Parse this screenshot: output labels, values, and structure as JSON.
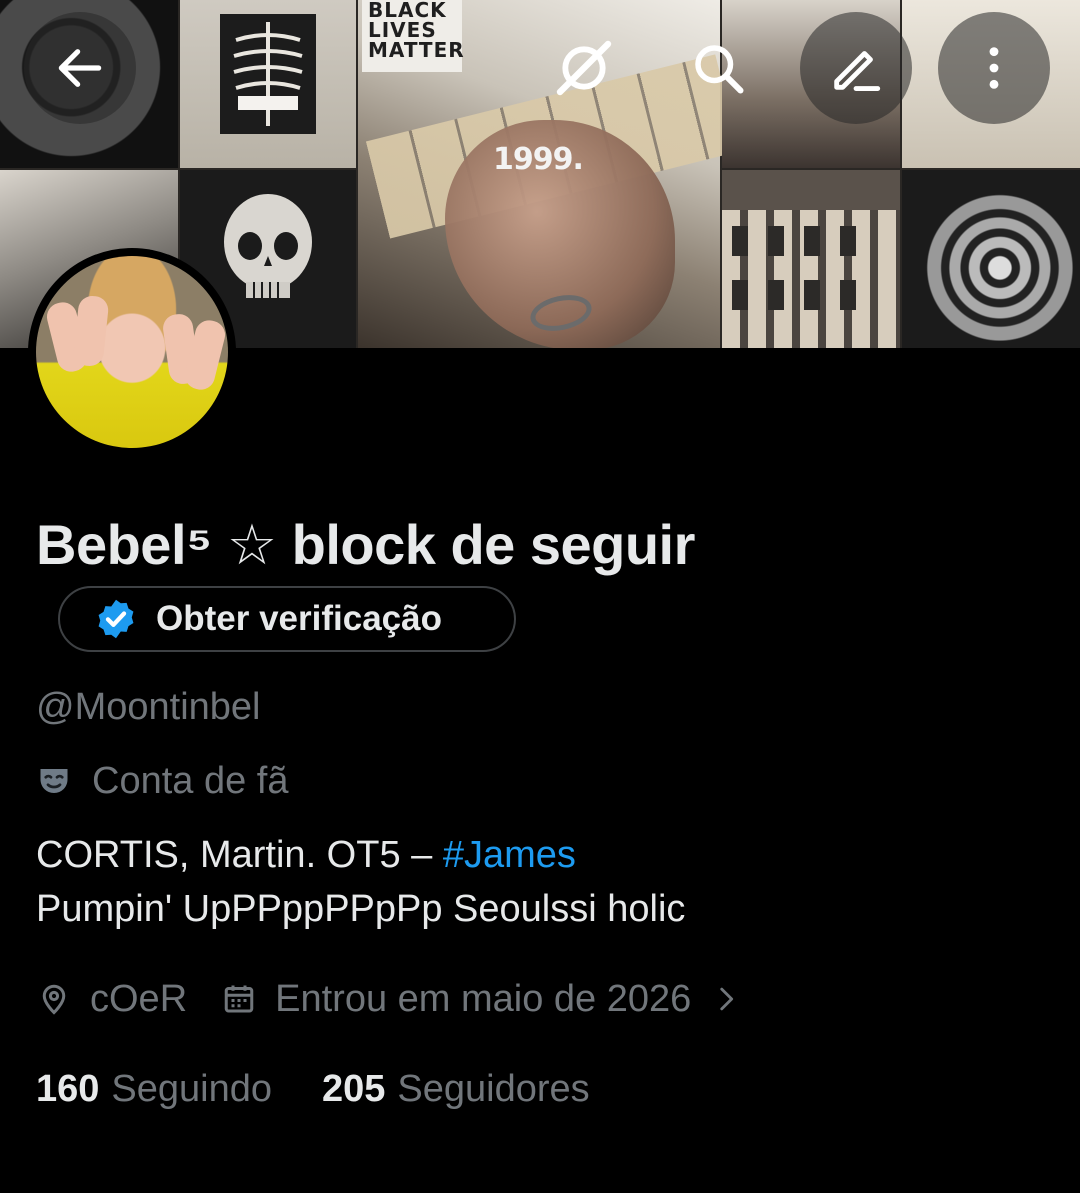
{
  "banner": {
    "sign_text": "BLACK\nLIVES\nMATTER",
    "year_text": "1999."
  },
  "topbar": {
    "back_icon": "arrow-left-icon",
    "grok_icon": "grok-icon",
    "search_icon": "search-icon",
    "edit_icon": "edit-pencil-icon",
    "more_icon": "more-vertical-icon"
  },
  "profile": {
    "display_name": "Bebel⁵ ☆ block de seguir",
    "verify_button_label": "Obter verificação",
    "handle": "@Moontinbel",
    "category": "Conta de fã",
    "category_icon": "theater-masks-icon",
    "bio_line1_text": "CORTIS, Martin. OT5 – ",
    "bio_line1_hashtag": "#James",
    "bio_line2": "Pumpin' UpPPppPPpPp Seoulssi holic",
    "location": "cOeR",
    "location_icon": "location-pin-icon",
    "joined": "Entrou em maio de 2026",
    "joined_icon": "calendar-icon",
    "more_chevron_icon": "chevron-right-icon"
  },
  "stats": {
    "following_count": "160",
    "following_label": "Seguindo",
    "followers_count": "205",
    "followers_label": "Seguidores"
  },
  "colors": {
    "background": "#000000",
    "text_primary": "#e7e9ea",
    "text_secondary": "#71767b",
    "accent_blue": "#1d9bf0"
  }
}
